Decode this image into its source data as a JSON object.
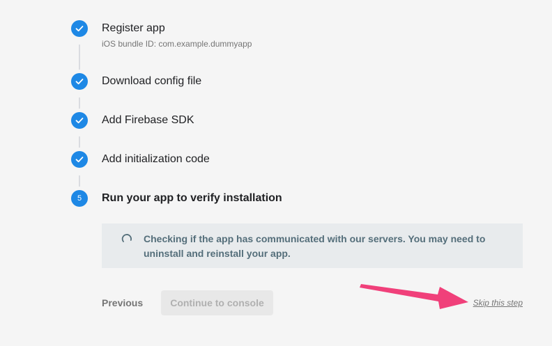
{
  "steps": [
    {
      "title": "Register app",
      "subtitle": "iOS bundle ID: com.example.dummyapp",
      "state": "done"
    },
    {
      "title": "Download config file",
      "state": "done"
    },
    {
      "title": "Add Firebase SDK",
      "state": "done"
    },
    {
      "title": "Add initialization code",
      "state": "done"
    },
    {
      "title": "Run your app to verify installation",
      "number": "5",
      "state": "active"
    }
  ],
  "status": {
    "text": "Checking if the app has communicated with our servers. You may need to uninstall and reinstall your app."
  },
  "actions": {
    "previous_label": "Previous",
    "continue_label": "Continue to console",
    "skip_label": "Skip this step"
  },
  "colors": {
    "accent": "#1e88e5",
    "annotation_arrow": "#f0407a"
  }
}
